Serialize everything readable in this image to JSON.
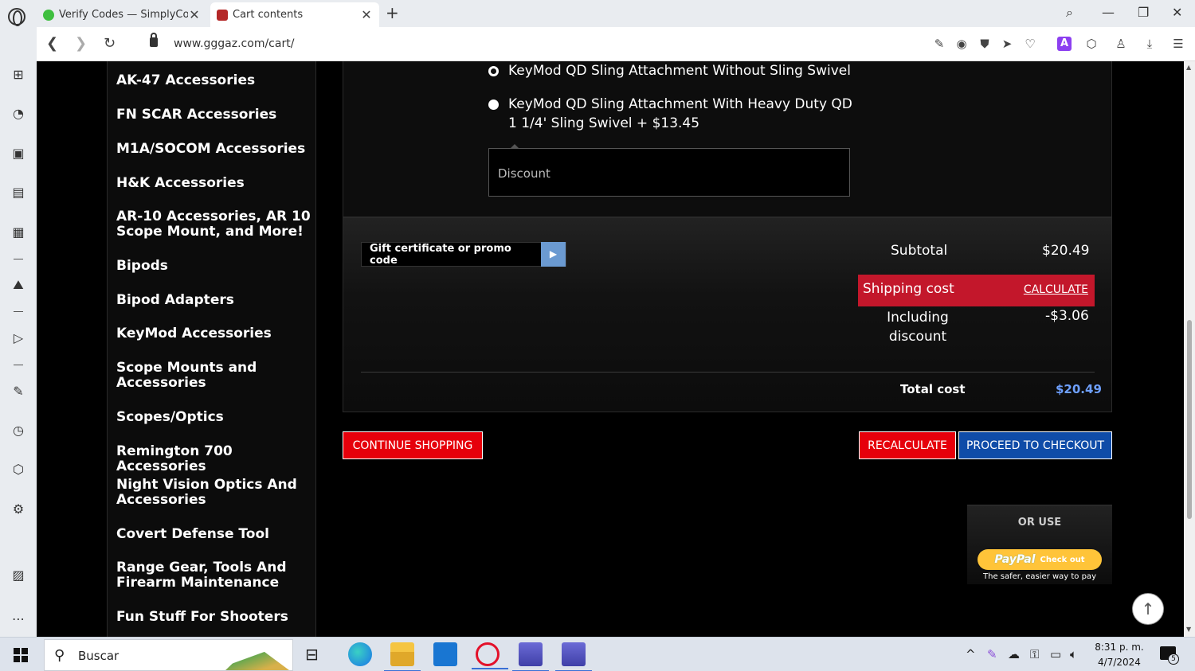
{
  "browser": {
    "tabs": [
      {
        "title": "Verify Codes — SimplyCodes",
        "active": false
      },
      {
        "title": "Cart contents",
        "active": true
      }
    ],
    "url": "www.gggaz.com/cart/"
  },
  "categories": [
    "AK-47 Accessories",
    "FN SCAR Accessories",
    "M1A/SOCOM Accessories",
    "H&K Accessories",
    "AR-10 Accessories, AR 10 Scope Mount, and More!",
    "Bipods",
    "Bipod Adapters",
    "KeyMod Accessories",
    "Scope Mounts and Accessories",
    "Scopes/Optics",
    "Remington 700 Accessories",
    "Night Vision Optics And Accessories",
    "Covert Defense Tool",
    "Range Gear, Tools And Firearm Maintenance",
    "Fun Stuff For Shooters"
  ],
  "options": {
    "option1": "KeyMod QD Sling Attachment Without Sling Swivel",
    "option2": "KeyMod QD Sling Attachment With Heavy Duty QD 1 1/4' Sling Swivel + $13.45",
    "discount_label": "Discount"
  },
  "totals": {
    "promo_placeholder": "Gift certificate or promo code",
    "subtotal_label": "Subtotal",
    "subtotal_value": "$20.49",
    "shipping_label": "Shipping cost",
    "calculate_label": "CALCULATE",
    "including_label": "Including discount",
    "including_value": "-$3.06",
    "total_label": "Total cost",
    "total_value": "$20.49"
  },
  "buttons": {
    "continue": "CONTINUE SHOPPING",
    "recalculate": "RECALCULATE",
    "checkout": "PROCEED TO CHECKOUT"
  },
  "paypal": {
    "or_use": "OR USE",
    "brand": "PayPal",
    "checkout": "Check out",
    "tagline": "The safer, easier way to pay"
  },
  "taskbar": {
    "search_placeholder": "Buscar",
    "time": "8:31 p. m.",
    "date": "4/7/2024",
    "notifications": "5"
  },
  "colors": {
    "accent_red": "#e6000b",
    "shipping_red": "#c3172b",
    "checkout_blue": "#0f4ca8",
    "total_blue": "#6ea0ff"
  }
}
